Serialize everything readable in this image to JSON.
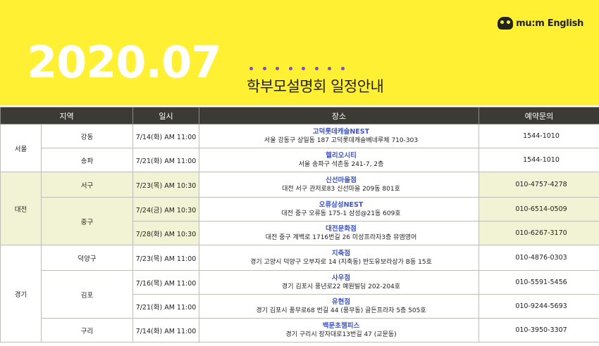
{
  "header": {
    "logo_icon": "owl-icon",
    "logo_text": "mu:m English",
    "year_month": "2020.07",
    "title": "학부모설명회 일정안내",
    "bg_color": "#fff033",
    "accent_color": "#7d4bd8"
  },
  "table": {
    "columns": [
      "지역",
      "일시",
      "장소",
      "예약문의"
    ],
    "rows": [
      {
        "region": "서울",
        "district": "강동",
        "date": "7/14(화) AM 11:00",
        "place": "고덕롯데캐슬NEST",
        "address": "서울 강동구 상일동 187 고덕롯데캐슬베네루체 710-303",
        "phone": "1544-1010"
      },
      {
        "region": "서울",
        "district": "송파",
        "date": "7/21(화) AM 11:00",
        "place": "헬리오시티",
        "address": "서울 송파구 석촌동 241-7, 2층",
        "phone": "1544-1010"
      },
      {
        "region": "대전",
        "district": "서구",
        "date": "7/23(목) AM 10:30",
        "place": "신선마을점",
        "address": "대전 서구 관저로83 신선마을 209동 801호",
        "phone": "010-4757-4278"
      },
      {
        "region": "대전",
        "district": "중구",
        "date": "7/24(금) AM 10:30",
        "place": "오류삼성NEST",
        "address": "대전 중구 오류동 175-1 삼성@21동 609호",
        "phone": "010-6514-0509"
      },
      {
        "region": "대전",
        "district": "중구",
        "date": "7/28(화) AM 10:30",
        "place": "대전문화점",
        "address": "대전 중구 계백로 1716번길 26 미성프라자3층 뮤엠영어",
        "phone": "010-6267-3170"
      },
      {
        "region": "경기",
        "district": "덕양구",
        "date": "7/23(목) AM 11:00",
        "place": "지축점",
        "address": "경기 고양시 덕양구 오부자로 14 (지축동) 반도유보라상가 B동 15호",
        "phone": "010-4876-0303"
      },
      {
        "region": "경기",
        "district": "김포",
        "date": "7/16(목) AM 11:00",
        "place": "사우점",
        "address": "경기 김포시 풍년로22 예원빌딩 202-204호",
        "phone": "010-5591-5456"
      },
      {
        "region": "경기",
        "district": "김포",
        "date": "7/21(화) AM 11:00",
        "place": "유현점",
        "address": "경기 김포시 풍무로68 번길 44 (풍무동) 골든프라자 5층 505호",
        "phone": "010-9244-5693"
      },
      {
        "region": "경기",
        "district": "구리",
        "date": "7/14(화) AM 11:00",
        "place": "백문초챔피스",
        "address": "경기 구리시 장자대로13번길 47 (교문동)",
        "phone": "010-3950-3307"
      }
    ]
  }
}
